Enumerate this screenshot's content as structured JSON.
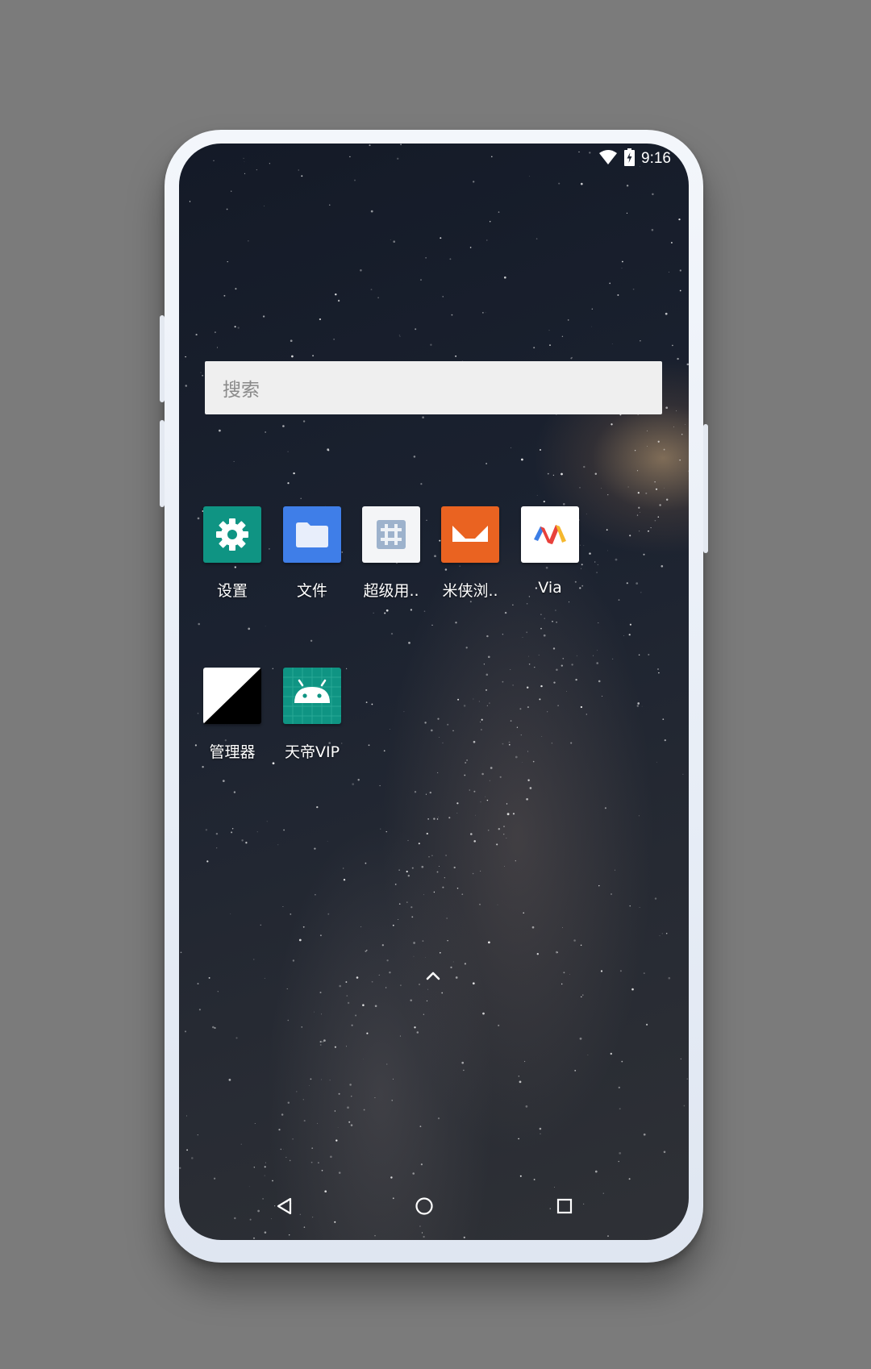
{
  "status_bar": {
    "time": "9:16",
    "wifi_icon": "wifi-icon",
    "battery_icon": "battery-charging-icon"
  },
  "search": {
    "placeholder": "搜索"
  },
  "apps": [
    {
      "label": "设置",
      "icon": "settings-gear-icon",
      "color": "#0f9483"
    },
    {
      "label": "文件",
      "icon": "folder-icon",
      "color": "#3f7ee8"
    },
    {
      "label": "超级用..",
      "icon": "hash-grid-icon",
      "color": "#f4f5f7"
    },
    {
      "label": "米侠浏..",
      "icon": "mixia-browser-icon",
      "color": "#ea6321"
    },
    {
      "label": "Via",
      "icon": "via-browser-icon",
      "color": "#ffffff"
    },
    {
      "label": "管理器",
      "icon": "diagonal-split-icon",
      "color": "#000000"
    },
    {
      "label": "天帝VIP",
      "icon": "android-robot-icon",
      "color": "#0f9483"
    }
  ],
  "app_drawer_icon": "chevron-up-icon",
  "navigation": {
    "back_icon": "back-triangle-icon",
    "home_icon": "home-circle-icon",
    "recents_icon": "recents-square-icon"
  }
}
